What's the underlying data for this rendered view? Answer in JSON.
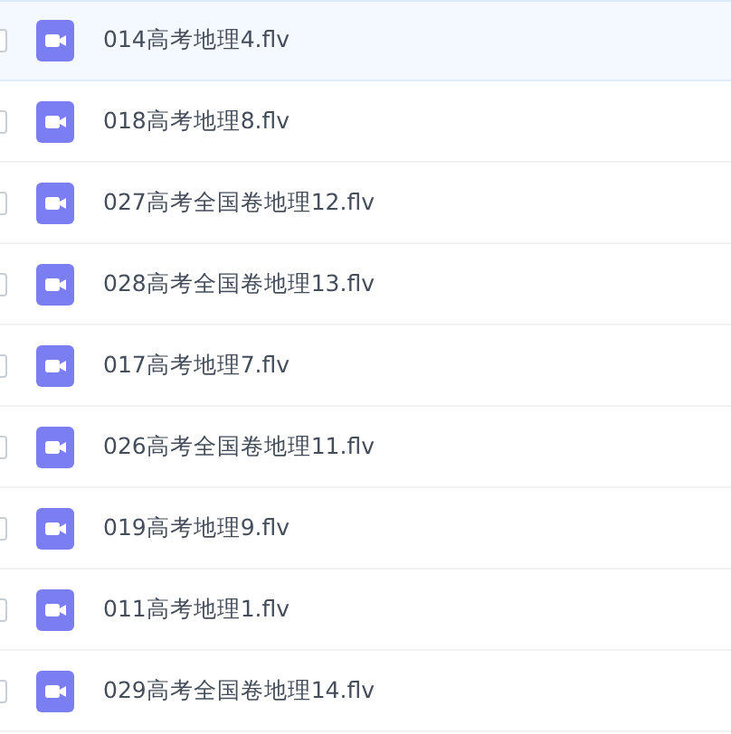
{
  "files": [
    {
      "name": "014高考地理4.flv",
      "selected": true
    },
    {
      "name": "018高考地理8.flv",
      "selected": false
    },
    {
      "name": "027高考全国卷地理12.flv",
      "selected": false
    },
    {
      "name": "028高考全国卷地理13.flv",
      "selected": false
    },
    {
      "name": "017高考地理7.flv",
      "selected": false
    },
    {
      "name": "026高考全国卷地理11.flv",
      "selected": false
    },
    {
      "name": "019高考地理9.flv",
      "selected": false
    },
    {
      "name": "011高考地理1.flv",
      "selected": false
    },
    {
      "name": "029高考全国卷地理14.flv",
      "selected": false
    }
  ]
}
